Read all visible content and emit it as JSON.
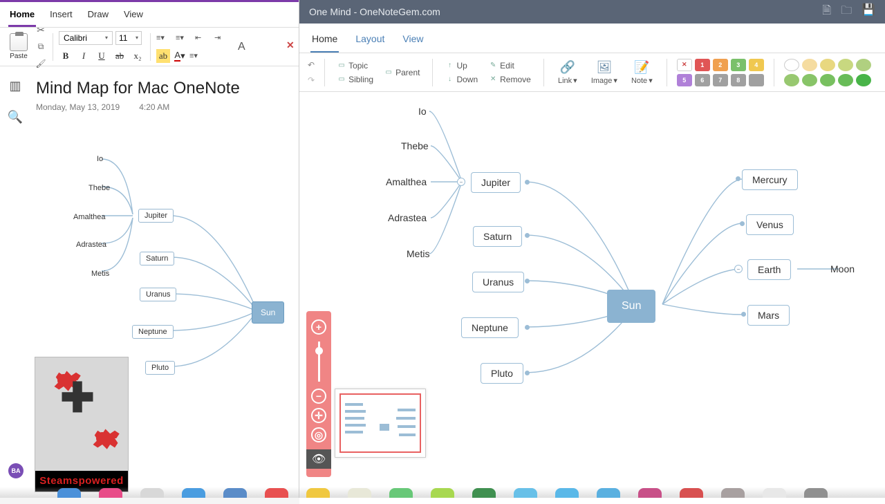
{
  "onenote": {
    "tabs": [
      "Home",
      "Insert",
      "Draw",
      "View"
    ],
    "paste_label": "Paste",
    "font_name": "Calibri",
    "font_size": "11",
    "page_title": "Mind Map for Mac OneNote",
    "page_date": "Monday, May 13, 2019",
    "page_time": "4:20 AM",
    "avatar_initials": "BA",
    "mini_nodes": {
      "central": "Sun",
      "planets": [
        "Jupiter",
        "Saturn",
        "Uranus",
        "Neptune",
        "Pluto"
      ],
      "moons": [
        "Io",
        "Thebe",
        "Amalthea",
        "Adrastea",
        "Metis"
      ]
    }
  },
  "onemind": {
    "title": "One Mind - OneNoteGem.com",
    "tabs": [
      "Home",
      "Layout",
      "View"
    ],
    "ribbon": {
      "topic": "Topic",
      "parent": "Parent",
      "sibling": "Sibling",
      "up": "Up",
      "down": "Down",
      "edit": "Edit",
      "remove": "Remove",
      "link": "Link",
      "image": "Image",
      "note": "Note"
    },
    "priority_numbers": [
      "1",
      "2",
      "3",
      "4",
      "5",
      "6",
      "7",
      "8"
    ],
    "priority_colors": [
      "#e05555",
      "#f0a050",
      "#7ac06a",
      "#f0c850",
      "#b080d8",
      "#a0a0a0",
      "#a0a0a0",
      "#a0a0a0"
    ],
    "progress_colors": [
      "#f5dca0",
      "#e8d880",
      "#c8d880",
      "#b0d080",
      "#98c870",
      "#88c468",
      "#78c060",
      "#68bc58",
      "#58b850",
      "#48b448"
    ],
    "nodes": {
      "central": "Sun",
      "left_planets": [
        "Jupiter",
        "Saturn",
        "Uranus",
        "Neptune",
        "Pluto"
      ],
      "jupiter_moons": [
        "Io",
        "Thebe",
        "Amalthea",
        "Adrastea",
        "Metis"
      ],
      "right_planets": [
        "Mercury",
        "Venus",
        "Earth",
        "Mars"
      ],
      "earth_moon": "Moon"
    }
  },
  "steam": {
    "label": "Steamspowered"
  },
  "dock_colors": [
    "#4a90d9",
    "#e84c88",
    "#d8d8d8",
    "#4a9de0",
    "#5a8cc8",
    "#e85050",
    "#f0c840",
    "#e8e8d8",
    "#68c878",
    "#a8d850",
    "#409050",
    "#68c0e8",
    "#5ab8e8",
    "#5ab0e0",
    "#c85088",
    "#d85050",
    "#a8a0a0",
    "#e8e8e8",
    "#909090"
  ]
}
